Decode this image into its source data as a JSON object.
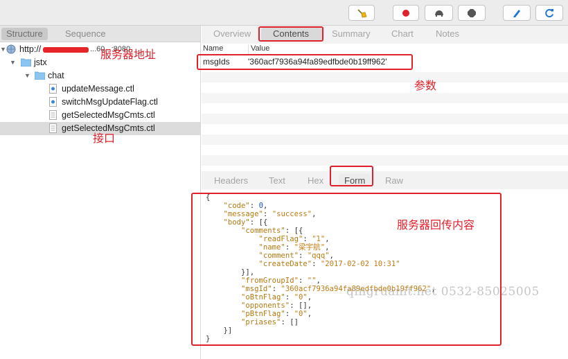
{
  "left_panel": {
    "tabs": [
      "Structure",
      "Sequence"
    ],
    "tree": [
      {
        "label": "http://",
        "trail": "...60...:8080",
        "level": 0
      },
      {
        "label": "jstx",
        "level": 1
      },
      {
        "label": "chat",
        "level": 2
      },
      {
        "label": "updateMessage.ctl",
        "level": 3
      },
      {
        "label": "switchMsgUpdateFlag.ctl",
        "level": 3
      },
      {
        "label": "getSelectedMsgCmts.ctl",
        "level": 3
      },
      {
        "label": "getSelectedMsgCmts.ctl",
        "level": 3
      }
    ]
  },
  "top_tabs": [
    "Overview",
    "Contents",
    "Summary",
    "Chart",
    "Notes"
  ],
  "params": {
    "col_name": "Name",
    "col_value": "Value",
    "row_name": "msgIds",
    "row_value": "'360acf7936a94fa89edfbde0b19ff962'"
  },
  "bottom_tabs": [
    "Headers",
    "Text",
    "Hex",
    "Form",
    "Raw"
  ],
  "json_lines": [
    "{",
    "    \"code\": 0,",
    "    \"message\": \"success\",",
    "    \"body\": [{",
    "        \"comments\": [{",
    "            \"readFlag\": \"1\",",
    "            \"name\": \"梁宇航\",",
    "            \"comment\": \"qqq\",",
    "            \"createDate\": \"2017-02-02 10:31\"",
    "        }],",
    "        \"fromGroupId\": \"\",",
    "        \"msgId\": \"360acf7936a94fa89edfbde0b19ff962\",",
    "        \"oBtnFlag\": \"0\",",
    "        \"opponents\": [],",
    "        \"pBtnFlag\": \"0\",",
    "        \"priases\": []",
    "    }]",
    "}"
  ],
  "annotations": {
    "server_address": "服务器地址",
    "interface": "接口",
    "parameters": "参数",
    "server_response": "服务器回传内容"
  },
  "watermark": "qingruanit.net 0532-85025005",
  "colors": {
    "annotation_red": "#e0202a",
    "record_red": "#e0202a",
    "refresh_blue": "#1d73d9"
  },
  "toolbar_icons": [
    "broom-icon",
    "record-icon",
    "turtle-icon",
    "stop-icon",
    "pen-icon",
    "refresh-icon"
  ]
}
